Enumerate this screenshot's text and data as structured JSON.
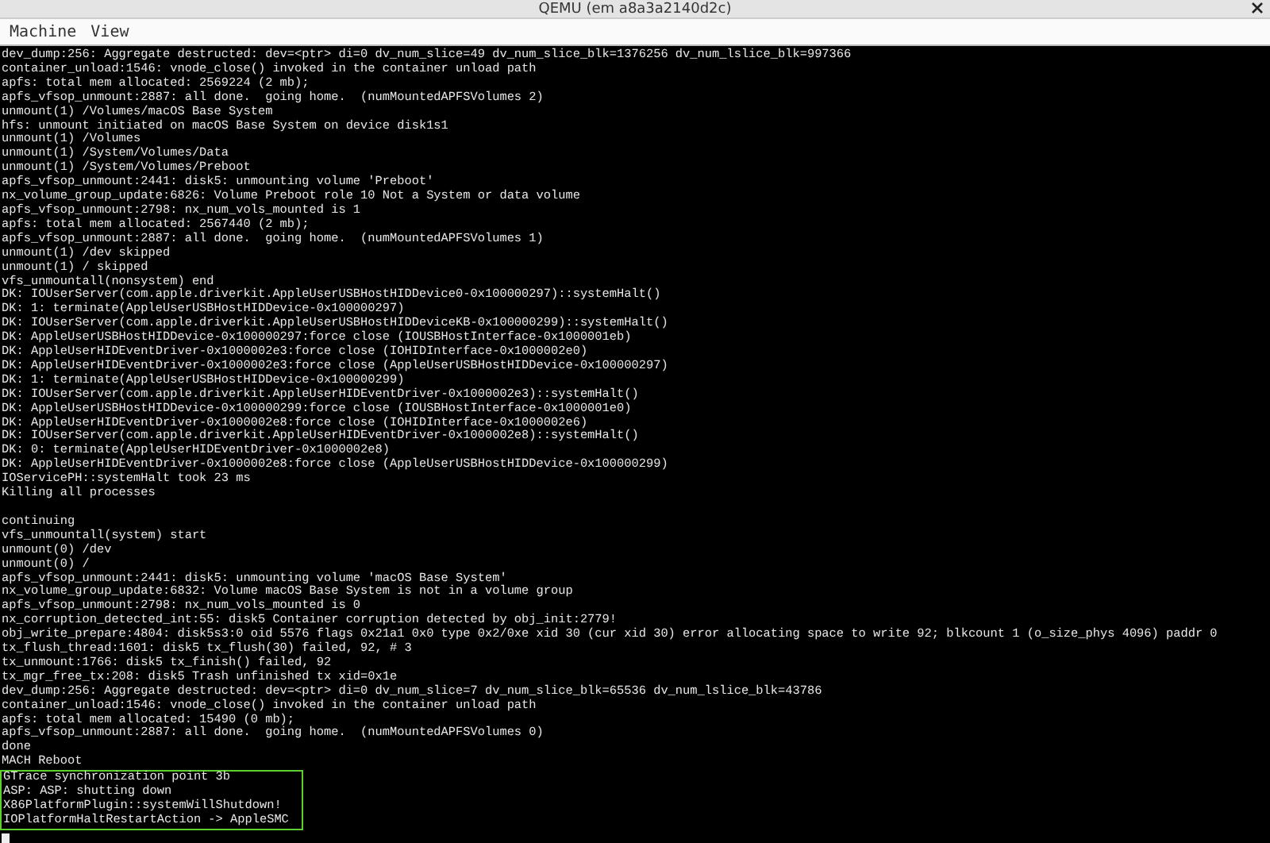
{
  "window": {
    "title": "QEMU (em a8a3a2140d2c)"
  },
  "menu": [
    {
      "label": "Machine"
    },
    {
      "label": "View"
    }
  ],
  "console": {
    "sections": [
      {
        "lines": [
          "dev_dump:256: Aggregate destructed: dev=<ptr> di=0 dv_num_slice=49 dv_num_slice_blk=1376256 dv_num_lslice_blk=997366",
          "container_unload:1546: vnode_close() invoked in the container unload path",
          "apfs: total mem allocated: 2569224 (2 mb);",
          "apfs_vfsop_unmount:2887: all done.  going home.  (numMountedAPFSVolumes 2)",
          "unmount(1) /Volumes/macOS Base System",
          "hfs: unmount initiated on macOS Base System on device disk1s1",
          "unmount(1) /Volumes",
          "unmount(1) /System/Volumes/Data",
          "unmount(1) /System/Volumes/Preboot",
          "apfs_vfsop_unmount:2441: disk5: unmounting volume 'Preboot'",
          "nx_volume_group_update:6826: Volume Preboot role 10 Not a System or data volume",
          "apfs_vfsop_unmount:2798: nx_num_vols_mounted is 1",
          "apfs: total mem allocated: 2567440 (2 mb);",
          "apfs_vfsop_unmount:2887: all done.  going home.  (numMountedAPFSVolumes 1)",
          "unmount(1) /dev skipped",
          "unmount(1) / skipped",
          "vfs_unmountall(nonsystem) end",
          "DK: IOUserServer(com.apple.driverkit.AppleUserUSBHostHIDDevice0-0x100000297)::systemHalt()",
          "DK: 1: terminate(AppleUserUSBHostHIDDevice-0x100000297)",
          "DK: IOUserServer(com.apple.driverkit.AppleUserUSBHostHIDDeviceKB-0x100000299)::systemHalt()",
          "DK: AppleUserUSBHostHIDDevice-0x100000297:force close (IOUSBHostInterface-0x1000001eb)",
          "DK: AppleUserHIDEventDriver-0x1000002e3:force close (IOHIDInterface-0x1000002e0)",
          "DK: AppleUserHIDEventDriver-0x1000002e3:force close (AppleUserUSBHostHIDDevice-0x100000297)",
          "DK: 1: terminate(AppleUserUSBHostHIDDevice-0x100000299)",
          "DK: IOUserServer(com.apple.driverkit.AppleUserHIDEventDriver-0x1000002e3)::systemHalt()",
          "DK: AppleUserUSBHostHIDDevice-0x100000299:force close (IOUSBHostInterface-0x1000001e0)",
          "DK: AppleUserHIDEventDriver-0x1000002e8:force close (IOHIDInterface-0x1000002e6)",
          "DK: IOUserServer(com.apple.driverkit.AppleUserHIDEventDriver-0x1000002e8)::systemHalt()",
          "DK: 0: terminate(AppleUserHIDEventDriver-0x1000002e8)",
          "DK: AppleUserHIDEventDriver-0x1000002e8:force close (AppleUserUSBHostHIDDevice-0x100000299)",
          "IOServicePH::systemHalt took 23 ms",
          "Killing all processes"
        ]
      },
      {
        "lines": [
          "continuing",
          "vfs_unmountall(system) start",
          "unmount(0) /dev",
          "unmount(0) /",
          "apfs_vfsop_unmount:2441: disk5: unmounting volume 'macOS Base System'",
          "nx_volume_group_update:6832: Volume macOS Base System is not in a volume group",
          "apfs_vfsop_unmount:2798: nx_num_vols_mounted is 0",
          "nx_corruption_detected_int:55: disk5 Container corruption detected by obj_init:2779!",
          "obj_write_prepare:4804: disk5s3:0 oid 5576 flags 0x21a1 0x0 type 0x2/0xe xid 30 (cur xid 30) error allocating space to write 92; blkcount 1 (o_size_phys 4096) paddr 0",
          "tx_flush_thread:1601: disk5 tx_flush(30) failed, 92, # 3",
          "tx_unmount:1766: disk5 tx_finish() failed, 92",
          "tx_mgr_free_tx:208: disk5 Trash unfinished tx xid=0x1e",
          "dev_dump:256: Aggregate destructed: dev=<ptr> di=0 dv_num_slice=7 dv_num_slice_blk=65536 dv_num_lslice_blk=43786",
          "container_unload:1546: vnode_close() invoked in the container unload path",
          "apfs: total mem allocated: 15490 (0 mb);",
          "apfs_vfsop_unmount:2887: all done.  going home.  (numMountedAPFSVolumes 0)",
          "done",
          "MACH Reboot"
        ]
      }
    ],
    "highlighted_lines": [
      "GTrace synchronization point 3b",
      "ASP: ASP: shutting down",
      "X86PlatformPlugin::systemWillShutdown!",
      "IOPlatformHaltRestartAction -> AppleSMC"
    ]
  }
}
